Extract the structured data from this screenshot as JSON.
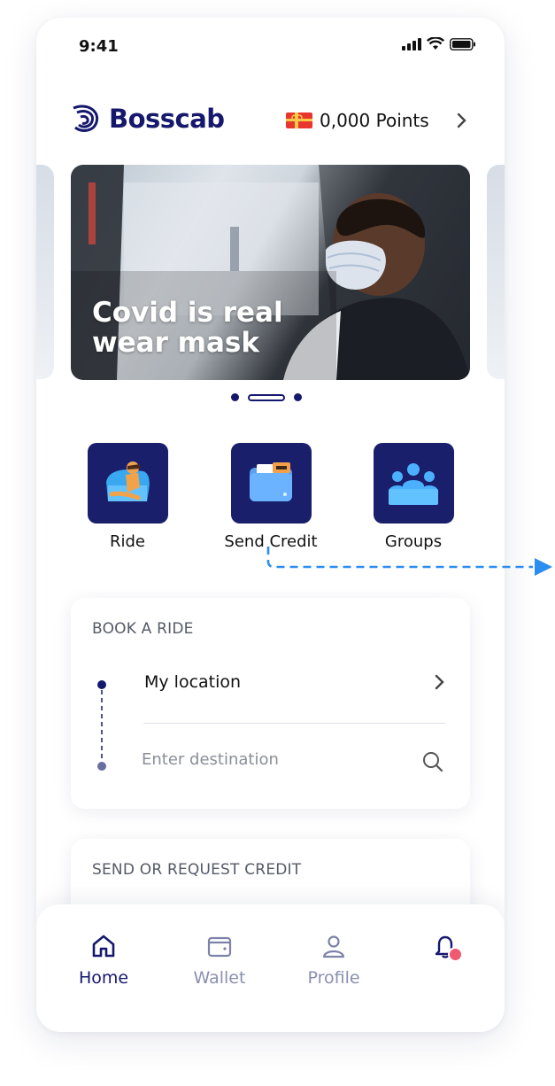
{
  "status_bar": {
    "time": "9:41"
  },
  "header": {
    "brand": "Bosscab",
    "points": "0,000 Points"
  },
  "banner": {
    "title_line1": "Covid is real",
    "title_line2": "wear mask",
    "active_index": 1,
    "count": 3
  },
  "actions": [
    {
      "label": "Ride",
      "icon": "ride-icon"
    },
    {
      "label": "Send Credit",
      "icon": "wallet-card-icon"
    },
    {
      "label": "Groups",
      "icon": "group-icon"
    }
  ],
  "book_ride": {
    "title": "BOOK A RIDE",
    "origin": "My location",
    "destination_placeholder": "Enter destination"
  },
  "credit_section": {
    "title": "SEND OR REQUEST CREDIT"
  },
  "bottom_nav": [
    {
      "label": "Home",
      "icon": "home-icon",
      "active": true
    },
    {
      "label": "Wallet",
      "icon": "wallet-icon",
      "active": false
    },
    {
      "label": "Profile",
      "icon": "profile-icon",
      "active": false
    },
    {
      "label": "",
      "icon": "bell-icon",
      "active": false
    }
  ],
  "colors": {
    "brand": "#15186d",
    "tile": "#1a1f6c",
    "accent_blue": "#2b8df0",
    "badge": "#ef5a72"
  }
}
